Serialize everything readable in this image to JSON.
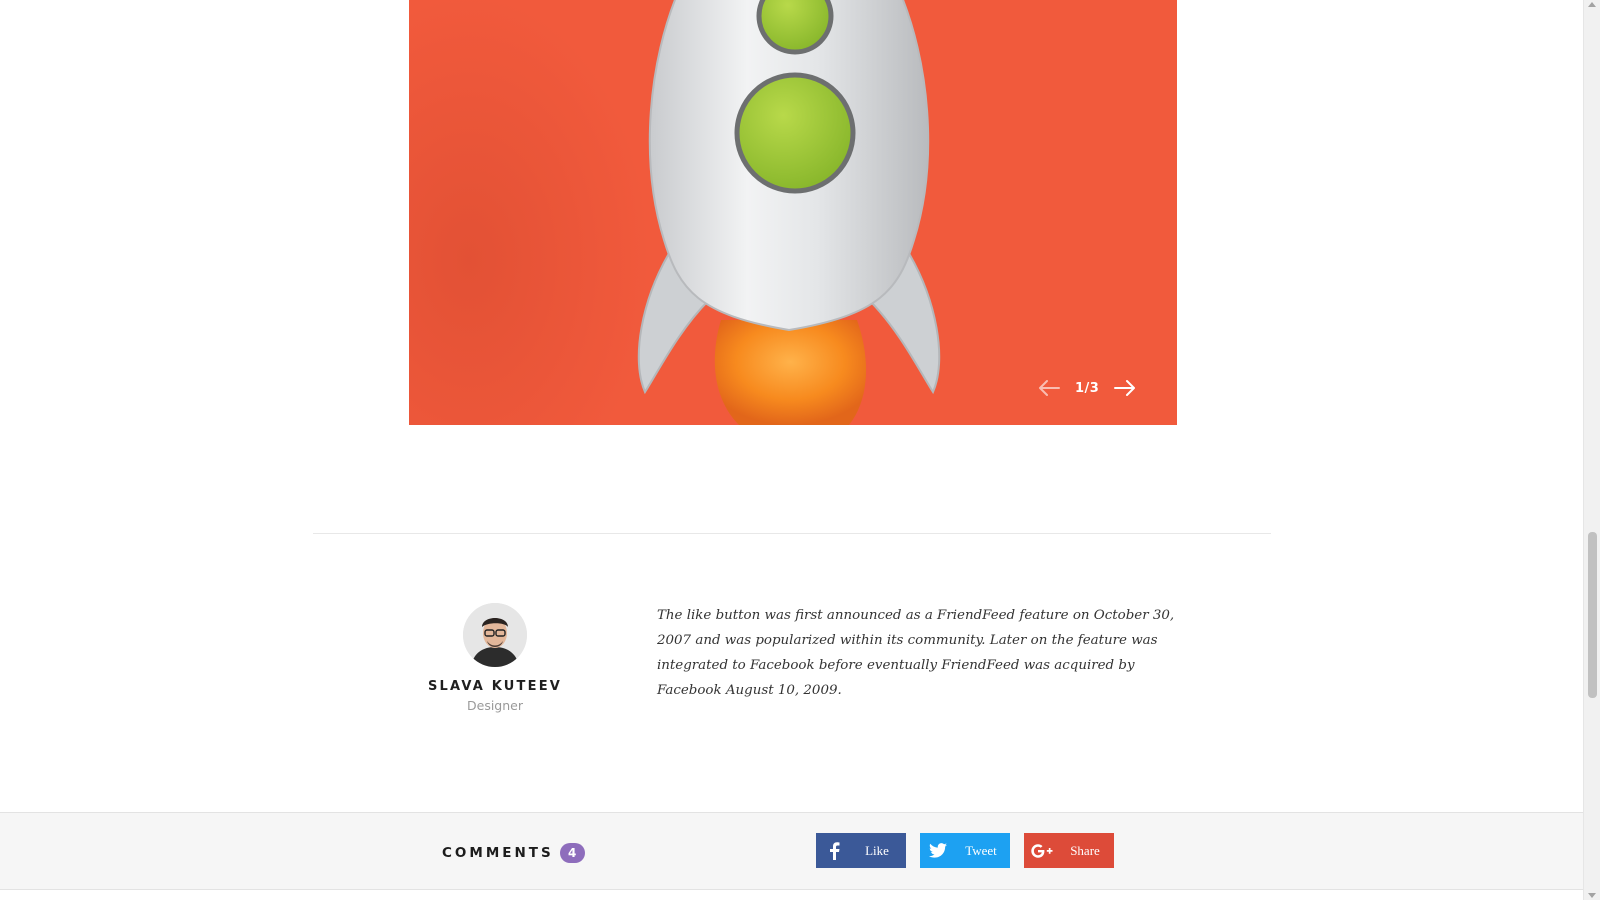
{
  "slider": {
    "counter": "1/3",
    "prev_icon": "arrow-left-icon",
    "next_icon": "arrow-right-icon",
    "background_color": "#f15a3c"
  },
  "author": {
    "name": "SLAVA KUTEEV",
    "role": "Designer",
    "avatar_icon": "avatar"
  },
  "quote": {
    "text": "The like button was first announced as a FriendFeed feature on October 30, 2007 and was popularized within its community. Later on the feature was integrated to Facebook before eventually FriendFeed was acquired by Facebook August 10, 2009."
  },
  "comments": {
    "label": "COMMENTS",
    "count": "4",
    "badge_color": "#8e6dbc"
  },
  "share": {
    "facebook_label": "Like",
    "twitter_label": "Tweet",
    "google_label": "Share",
    "facebook_color": "#3b5998",
    "twitter_color": "#1da1f2",
    "google_color": "#dd4b39"
  }
}
